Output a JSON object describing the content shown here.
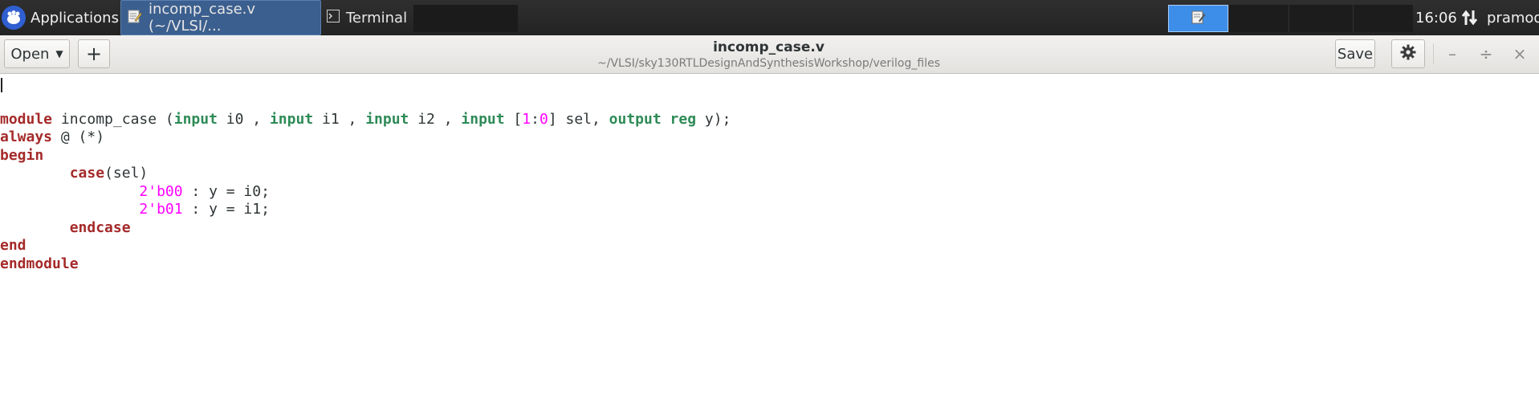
{
  "panel": {
    "applications_label": "Applications",
    "tasks": [
      {
        "label": "incomp_case.v (~/VLSI/..."
      },
      {
        "label": "Terminal"
      }
    ],
    "clock": "16:06",
    "user": "pramod"
  },
  "headerbar": {
    "open_label": "Open",
    "new_tab_label": "+",
    "title": "incomp_case.v",
    "subtitle": "~/VLSI/sky130RTLDesignAndSynthesisWorkshop/verilog_files",
    "save_label": "Save",
    "minimize": "–",
    "maximize": "÷",
    "close": "×"
  },
  "editor": {
    "lines": [
      [],
      [
        {
          "t": "module",
          "c": "kw"
        },
        {
          "t": " incomp_case (",
          "c": ""
        },
        {
          "t": "input",
          "c": "ty"
        },
        {
          "t": " i0 , ",
          "c": ""
        },
        {
          "t": "input",
          "c": "ty"
        },
        {
          "t": " i1 , ",
          "c": ""
        },
        {
          "t": "input",
          "c": "ty"
        },
        {
          "t": " i2 , ",
          "c": ""
        },
        {
          "t": "input",
          "c": "ty"
        },
        {
          "t": " [",
          "c": ""
        },
        {
          "t": "1",
          "c": "num"
        },
        {
          "t": ":",
          "c": ""
        },
        {
          "t": "0",
          "c": "num"
        },
        {
          "t": "] sel, ",
          "c": ""
        },
        {
          "t": "output",
          "c": "ty"
        },
        {
          "t": " ",
          "c": ""
        },
        {
          "t": "reg",
          "c": "ty"
        },
        {
          "t": " y);",
          "c": ""
        }
      ],
      [
        {
          "t": "always",
          "c": "kw"
        },
        {
          "t": " @ (*)",
          "c": ""
        }
      ],
      [
        {
          "t": "begin",
          "c": "kw"
        }
      ],
      [
        {
          "t": "\t",
          "c": ""
        },
        {
          "t": "case",
          "c": "kw"
        },
        {
          "t": "(sel)",
          "c": ""
        }
      ],
      [
        {
          "t": "\t\t",
          "c": ""
        },
        {
          "t": "2'b00",
          "c": "num"
        },
        {
          "t": " : y = i0;",
          "c": ""
        }
      ],
      [
        {
          "t": "\t\t",
          "c": ""
        },
        {
          "t": "2'b01",
          "c": "num"
        },
        {
          "t": " : y = i1;",
          "c": ""
        }
      ],
      [
        {
          "t": "\t",
          "c": ""
        },
        {
          "t": "endcase",
          "c": "kw"
        }
      ],
      [
        {
          "t": "end",
          "c": "kw"
        }
      ],
      [
        {
          "t": "endmodule",
          "c": "kw"
        }
      ]
    ]
  }
}
